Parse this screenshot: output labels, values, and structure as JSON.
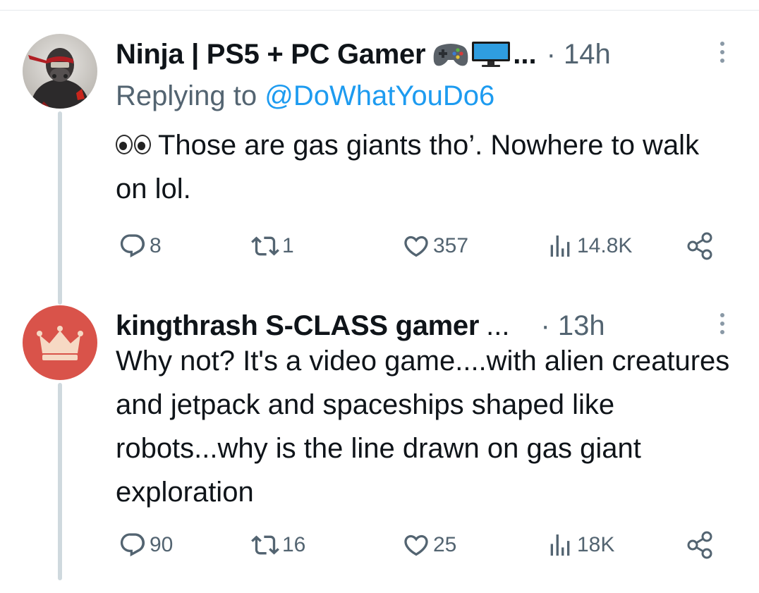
{
  "tweets": [
    {
      "display_name": "Ninja | PS5 + PC Gamer",
      "name_emojis": [
        "video-game-controller-icon",
        "desktop-computer-icon"
      ],
      "name_truncation": "...",
      "time": "· 14h",
      "replying_prefix": "Replying to",
      "replying_handle": "@DoWhatYouDo6",
      "body_emoji": "eyes-emoji",
      "body": "Those are gas giants tho’. Nowhere to walk on lol.",
      "replies": "8",
      "retweets": "1",
      "likes": "357",
      "views": "14.8K"
    },
    {
      "display_name": "kingthrash S-CLASS gamer",
      "name_truncation": "...",
      "time": "· 13h",
      "body": "Why not? It's a video game....with alien creatures and jetpack and spaceships shaped like robots...why is the line drawn on gas giant exploration",
      "replies": "90",
      "retweets": "16",
      "likes": "25",
      "views": "18K"
    }
  ],
  "colors": {
    "text_primary": "#0f1419",
    "text_secondary": "#536471",
    "link": "#1d9bf0",
    "thread_line": "#cfd9de",
    "avatar_crown_bg": "#d9534a"
  }
}
